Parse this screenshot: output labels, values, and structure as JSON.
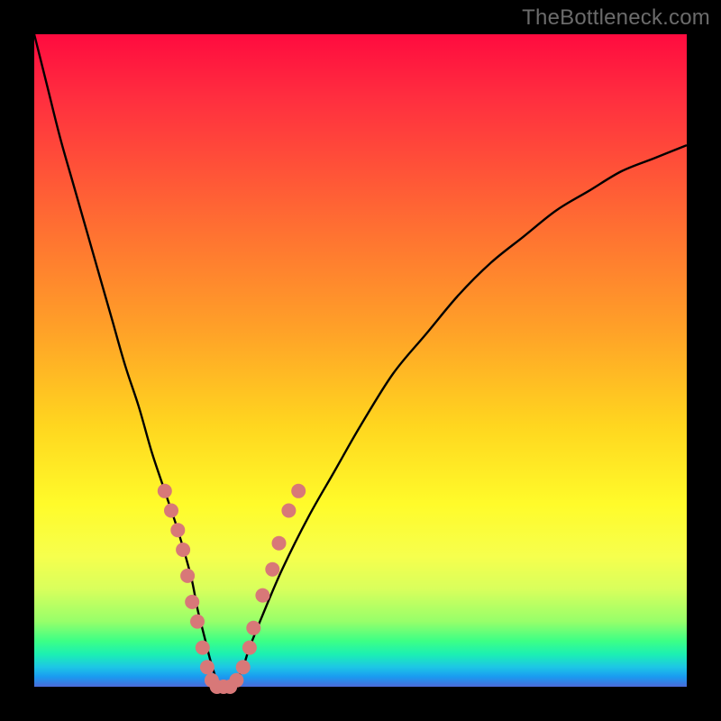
{
  "watermark": "TheBottleneck.com",
  "colors": {
    "curve": "#000000",
    "marker_fill": "#d87878",
    "marker_stroke": "#c46060"
  },
  "chart_data": {
    "type": "line",
    "title": "",
    "xlabel": "",
    "ylabel": "",
    "xlim": [
      0,
      100
    ],
    "ylim": [
      0,
      100
    ],
    "x": [
      0,
      2,
      4,
      6,
      8,
      10,
      12,
      14,
      16,
      18,
      20,
      22,
      24,
      25,
      26,
      27,
      28,
      29,
      30,
      31,
      32,
      33,
      35,
      38,
      42,
      46,
      50,
      55,
      60,
      65,
      70,
      75,
      80,
      85,
      90,
      95,
      100
    ],
    "series": [
      {
        "name": "bottleneck_curve",
        "values": [
          100,
          92,
          84,
          77,
          70,
          63,
          56,
          49,
          43,
          36,
          30,
          24,
          17,
          12,
          8,
          4,
          1,
          0,
          0,
          1,
          3,
          6,
          11,
          18,
          26,
          33,
          40,
          48,
          54,
          60,
          65,
          69,
          73,
          76,
          79,
          81,
          83
        ]
      }
    ],
    "markers": {
      "name": "highlighted_points",
      "points": [
        {
          "x": 20,
          "y": 30
        },
        {
          "x": 21,
          "y": 27
        },
        {
          "x": 22,
          "y": 24
        },
        {
          "x": 22.8,
          "y": 21
        },
        {
          "x": 23.5,
          "y": 17
        },
        {
          "x": 24.2,
          "y": 13
        },
        {
          "x": 25,
          "y": 10
        },
        {
          "x": 25.8,
          "y": 6
        },
        {
          "x": 26.5,
          "y": 3
        },
        {
          "x": 27.2,
          "y": 1
        },
        {
          "x": 28,
          "y": 0
        },
        {
          "x": 29,
          "y": 0
        },
        {
          "x": 30,
          "y": 0
        },
        {
          "x": 31,
          "y": 1
        },
        {
          "x": 32,
          "y": 3
        },
        {
          "x": 33,
          "y": 6
        },
        {
          "x": 33.6,
          "y": 9
        },
        {
          "x": 35,
          "y": 14
        },
        {
          "x": 36.5,
          "y": 18
        },
        {
          "x": 37.5,
          "y": 22
        },
        {
          "x": 39,
          "y": 27
        },
        {
          "x": 40.5,
          "y": 30
        }
      ]
    }
  }
}
